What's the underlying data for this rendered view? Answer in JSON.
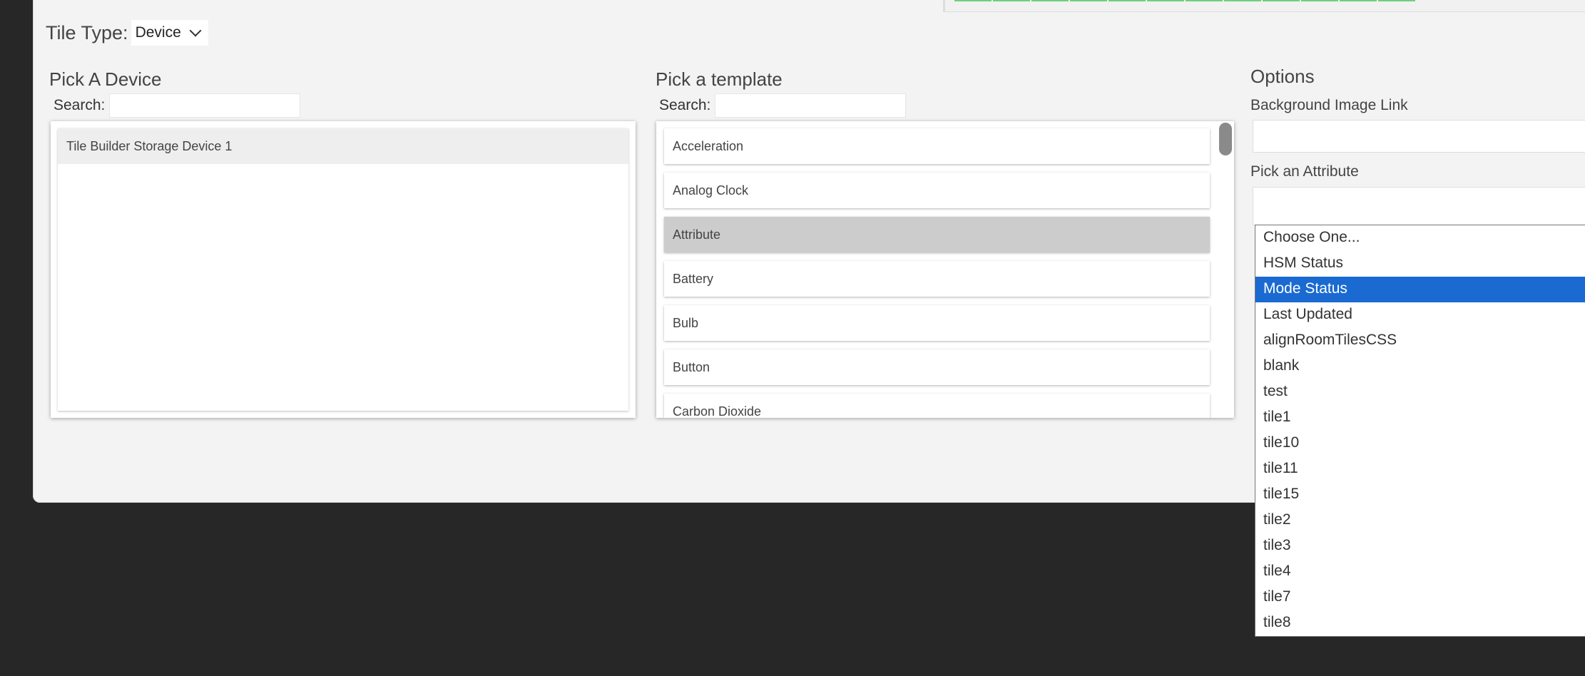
{
  "tile_type": {
    "label": "Tile Type:",
    "value": "Device"
  },
  "device_section": {
    "heading": "Pick A Device",
    "search_label": "Search:",
    "search_value": "",
    "items": [
      "Tile Builder Storage Device 1"
    ]
  },
  "template_section": {
    "heading": "Pick a template",
    "search_label": "Search:",
    "search_value": "",
    "selected": "Attribute",
    "items": [
      "Acceleration",
      "Analog Clock",
      "Attribute",
      "Battery",
      "Bulb",
      "Button",
      "Carbon Dioxide"
    ]
  },
  "options_section": {
    "heading": "Options",
    "background_image_label": "Background Image Link",
    "background_image_value": "",
    "attribute_label": "Pick an Attribute",
    "attribute_value": ""
  },
  "attribute_dropdown": {
    "highlighted": "Mode Status",
    "options": [
      "Choose One...",
      "HSM Status",
      "Mode Status",
      "Last Updated",
      "alignRoomTilesCSS",
      "blank",
      "test",
      "tile1",
      "tile10",
      "tile11",
      "tile15",
      "tile2",
      "tile3",
      "tile4",
      "tile7",
      "tile8"
    ]
  },
  "colors": {
    "background": "#272727",
    "dialog": "#f3f3f3",
    "highlight": "#1a6ad2",
    "selected_template": "#cccccc"
  }
}
